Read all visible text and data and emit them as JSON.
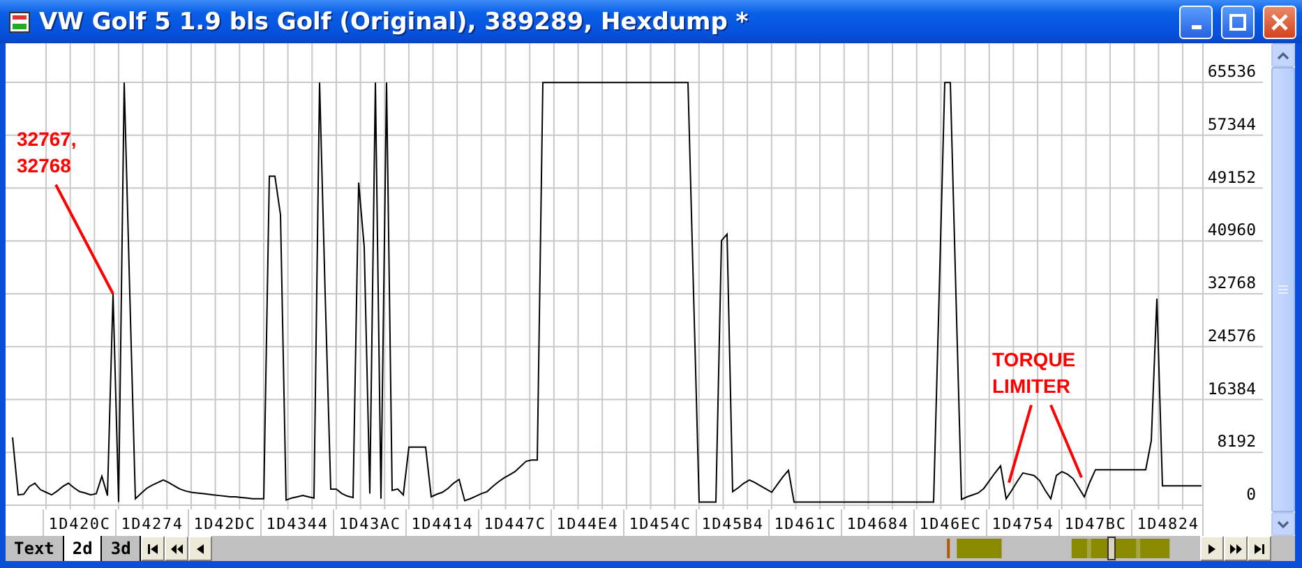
{
  "window": {
    "title": "VW Golf 5 1.9 bls Golf (Original), 389289, Hexdump *"
  },
  "chart": {
    "chart_data": {
      "type": "line",
      "ylim": [
        0,
        65536
      ],
      "grid": true,
      "yticks": [
        0,
        8192,
        16384,
        24576,
        32768,
        40960,
        49152,
        57344,
        65536
      ],
      "categories": [
        null,
        null,
        null,
        null,
        null,
        null,
        null,
        null,
        null,
        null,
        null,
        null,
        "1D420C",
        null,
        null,
        null,
        null,
        null,
        null,
        null,
        null,
        null,
        null,
        null,
        null,
        "1D4274",
        null,
        null,
        null,
        null,
        null,
        null,
        null,
        null,
        null,
        null,
        null,
        null,
        "1D42DC",
        null,
        null,
        null,
        null,
        null,
        null,
        null,
        null,
        null,
        null,
        null,
        null,
        "1D4344",
        null,
        null,
        null,
        null,
        null,
        null,
        null,
        null,
        null,
        null,
        null,
        null,
        "1D43AC",
        null,
        null,
        null,
        null,
        null,
        null,
        null,
        null,
        null,
        null,
        null,
        null,
        "1D4414",
        null,
        null,
        null,
        null,
        null,
        null,
        null,
        null,
        null,
        null,
        null,
        null,
        "1D447C",
        null,
        null,
        null,
        null,
        null,
        null,
        null,
        null,
        null,
        null,
        null,
        null,
        "1D44E4",
        null,
        null,
        null,
        null,
        null,
        null,
        null,
        null,
        null,
        null,
        null,
        null,
        "1D454C",
        null,
        null,
        null,
        null,
        null,
        null,
        null,
        null,
        null,
        null,
        null,
        null,
        "1D45B4",
        null,
        null,
        null,
        null,
        null,
        null,
        null,
        null,
        null,
        null,
        null,
        null,
        "1D461C",
        null,
        null,
        null,
        null,
        null,
        null,
        null,
        null,
        null,
        null,
        null,
        null,
        "1D4684",
        null,
        null,
        null,
        null,
        null,
        null,
        null,
        null,
        null,
        null,
        null,
        null,
        "1D46EC",
        null,
        null,
        null,
        null,
        null,
        null,
        null,
        null,
        null,
        null,
        null,
        null,
        "1D4754",
        null,
        null,
        null,
        null,
        null,
        null,
        null,
        null,
        null,
        null,
        null,
        null,
        "1D47BC",
        null,
        null,
        null,
        null,
        null,
        null,
        null,
        null,
        null,
        null,
        null,
        null,
        "1D4824",
        null,
        null,
        null,
        null,
        null,
        null
      ],
      "series": [
        {
          "color": "#000000",
          "values": [
            10500,
            1600,
            1700,
            2900,
            3400,
            2400,
            2000,
            1600,
            2200,
            2900,
            3400,
            2700,
            2100,
            1900,
            1600,
            1800,
            4500,
            1500,
            32800,
            500,
            65500,
            32800,
            1000,
            1800,
            2600,
            3100,
            3500,
            3900,
            3500,
            3000,
            2500,
            2200,
            2000,
            1900,
            1800,
            1700,
            1600,
            1500,
            1400,
            1300,
            1300,
            1200,
            1100,
            1000,
            1000,
            1000,
            51000,
            51000,
            45000,
            800,
            1100,
            1300,
            1500,
            1300,
            1100,
            65500,
            32800,
            2500,
            2500,
            1800,
            1400,
            1200,
            50000,
            40000,
            1800,
            65500,
            1000,
            65500,
            2300,
            2500,
            1600,
            9000,
            9000,
            9000,
            9000,
            1300,
            1700,
            2000,
            2600,
            3400,
            4000,
            700,
            1000,
            1400,
            1800,
            2100,
            2900,
            3600,
            4200,
            4700,
            5200,
            6000,
            6800,
            7000,
            7000,
            65500,
            65500,
            65500,
            65500,
            65500,
            65500,
            65500,
            65500,
            65500,
            65500,
            65500,
            65500,
            65500,
            65500,
            65500,
            65500,
            65500,
            65500,
            65500,
            65500,
            65500,
            65500,
            65500,
            65500,
            65500,
            65500,
            65500,
            32800,
            500,
            500,
            500,
            500,
            41000,
            42000,
            2100,
            2700,
            3400,
            3900,
            3500,
            3000,
            2500,
            2000,
            3200,
            4400,
            5400,
            500,
            500,
            500,
            500,
            500,
            500,
            500,
            500,
            500,
            500,
            500,
            500,
            500,
            500,
            500,
            500,
            500,
            500,
            500,
            500,
            500,
            500,
            500,
            500,
            500,
            500,
            32800,
            65500,
            65500,
            32800,
            900,
            1300,
            1600,
            1900,
            2600,
            3800,
            5000,
            6100,
            1000,
            2300,
            3700,
            5000,
            4800,
            4600,
            3800,
            2300,
            1000,
            4600,
            5200,
            4800,
            4100,
            2700,
            1300,
            3600,
            5500,
            5500,
            5500,
            5500,
            5500,
            5500,
            5500,
            5500,
            5500,
            5500,
            10000,
            32000,
            3000,
            3000,
            3000,
            3000,
            3000,
            3000,
            3000,
            3000
          ]
        }
      ],
      "annotations": [
        "32767, 32768",
        "TORQUE LIMITER"
      ]
    }
  },
  "tabs": [
    {
      "label": "Text",
      "selected": false
    },
    {
      "label": "2d",
      "selected": true
    },
    {
      "label": "3d",
      "selected": false
    }
  ]
}
